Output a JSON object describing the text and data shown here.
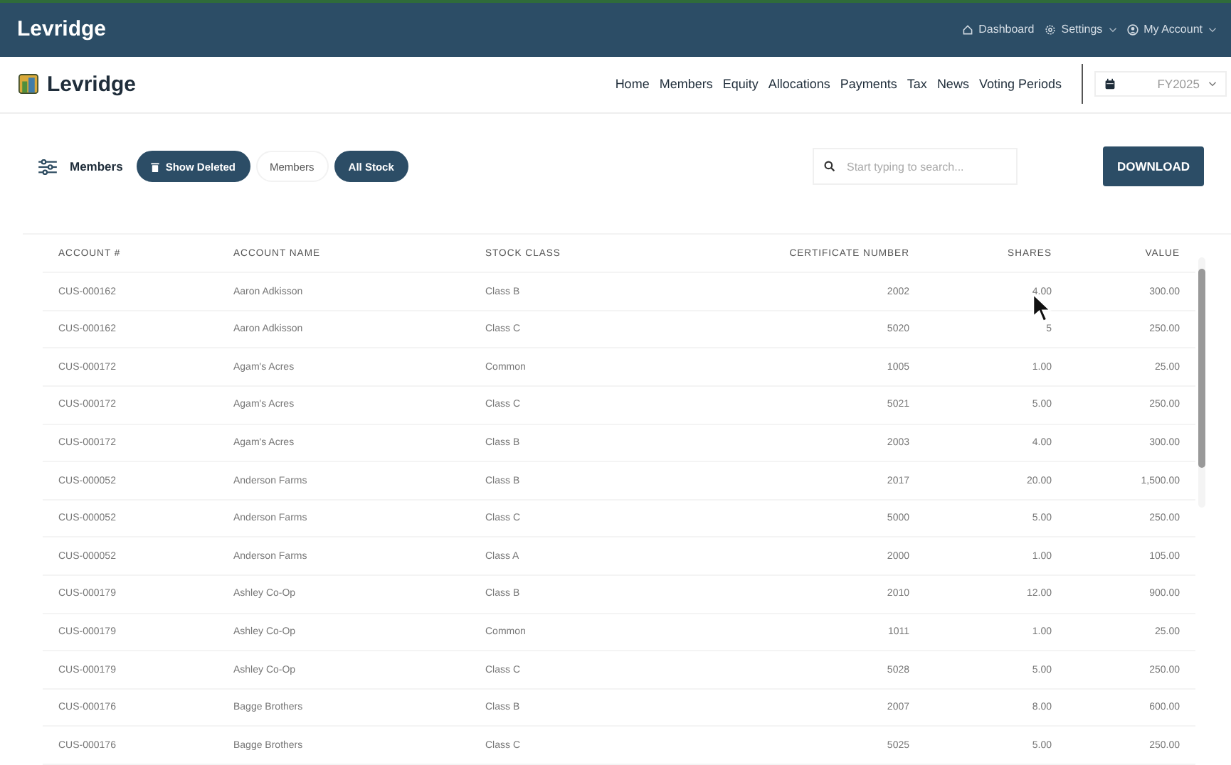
{
  "top_bar": {
    "brand": "Levridge",
    "links": [
      {
        "label": "Dashboard",
        "caret": false
      },
      {
        "label": "Settings",
        "caret": true
      },
      {
        "label": "My Account",
        "caret": true
      }
    ]
  },
  "nav": {
    "brand": "Levridge",
    "items": [
      {
        "label": "Home",
        "selected": false
      },
      {
        "label": "Members",
        "selected": false
      },
      {
        "label": "Equity",
        "selected": false
      },
      {
        "label": "Allocations",
        "selected": false
      },
      {
        "label": "Payments",
        "selected": false
      },
      {
        "label": "Tax",
        "selected": false
      },
      {
        "label": "News",
        "selected": false
      },
      {
        "label": "Voting Periods",
        "selected": false
      }
    ],
    "year": "FY2025"
  },
  "toolbar": {
    "title": "Members",
    "chips": [
      {
        "label": "Show Deleted",
        "selected": true
      },
      {
        "label": "Members",
        "selected": false
      },
      {
        "label": "All Stock",
        "selected": true
      }
    ],
    "search": {
      "placeholder": "Start typing to search..."
    },
    "download": "DOWNLOAD"
  },
  "table": {
    "columns": [
      "ACCOUNT #",
      "ACCOUNT NAME",
      "STOCK CLASS",
      "CERTIFICATE NUMBER",
      "SHARES",
      "VALUE"
    ],
    "rows": [
      [
        "CUS-000162",
        "Aaron Adkisson",
        "Class B",
        "2002",
        "4.00",
        "300.00"
      ],
      [
        "CUS-000162",
        "Aaron Adkisson",
        "Class C",
        "5020",
        "5",
        "250.00"
      ],
      [
        "CUS-000172",
        "Agam's Acres",
        "Common",
        "1005",
        "1.00",
        "25.00"
      ],
      [
        "CUS-000172",
        "Agam's Acres",
        "Class C",
        "5021",
        "5.00",
        "250.00"
      ],
      [
        "CUS-000172",
        "Agam's Acres",
        "Class B",
        "2003",
        "4.00",
        "300.00"
      ],
      [
        "CUS-000052",
        "Anderson Farms",
        "Class B",
        "2017",
        "20.00",
        "1,500.00"
      ],
      [
        "CUS-000052",
        "Anderson Farms",
        "Class C",
        "5000",
        "5.00",
        "250.00"
      ],
      [
        "CUS-000052",
        "Anderson Farms",
        "Class A",
        "2000",
        "1.00",
        "105.00"
      ],
      [
        "CUS-000179",
        "Ashley Co-Op",
        "Class B",
        "2010",
        "12.00",
        "900.00"
      ],
      [
        "CUS-000179",
        "Ashley Co-Op",
        "Common",
        "1011",
        "1.00",
        "25.00"
      ],
      [
        "CUS-000179",
        "Ashley Co-Op",
        "Class C",
        "5028",
        "5.00",
        "250.00"
      ],
      [
        "CUS-000176",
        "Bagge Brothers",
        "Class B",
        "2007",
        "8.00",
        "600.00"
      ],
      [
        "CUS-000176",
        "Bagge Brothers",
        "Class C",
        "5025",
        "5.00",
        "250.00"
      ]
    ]
  }
}
